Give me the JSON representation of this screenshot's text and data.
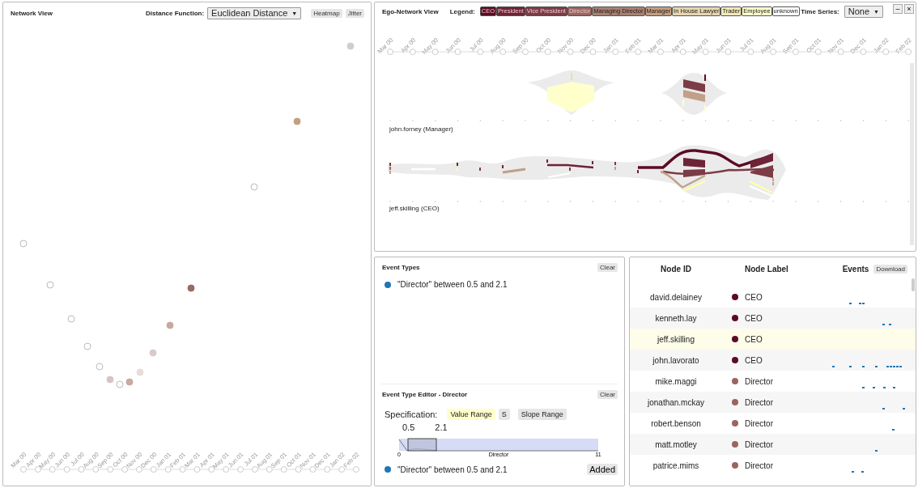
{
  "network_view": {
    "title": "Network View",
    "distance_label": "Distance Function:",
    "distance_value": "Euclidean Distance",
    "dropdown_arrow": "▼",
    "buttons": [
      "Heatmap",
      "Jitter"
    ],
    "timeline": [
      "Mar 00",
      "Apr 00",
      "May 00",
      "Jun 00",
      "Jul 00",
      "Aug 00",
      "Sep 00",
      "Oct 00",
      "Nov 00",
      "Dec 00",
      "Jan 01",
      "Feb 01",
      "Mar 01",
      "Apr 01",
      "May 01",
      "Jun 01",
      "Jul 01",
      "Aug 01",
      "Sep 01",
      "Oct 01",
      "Nov 01",
      "Dec 01",
      "Jan 02",
      "Feb 02"
    ]
  },
  "ego_view": {
    "title": "Ego-Network View",
    "legend_label": "Legend:",
    "legend": [
      {
        "label": "CEO",
        "color": "#5c0b24"
      },
      {
        "label": "President",
        "color": "#6e2336"
      },
      {
        "label": "Vice President",
        "color": "#7c3c45"
      },
      {
        "label": "Director",
        "color": "#9a6560"
      },
      {
        "label": "Managing Director",
        "color": "#a88070"
      },
      {
        "label": "Manager",
        "color": "#c49c80"
      },
      {
        "label": "In House Lawyer",
        "color": "#e6d6b0"
      },
      {
        "label": "Trader",
        "color": "#f2e8b8"
      },
      {
        "label": "Employee",
        "color": "#ffffcc"
      },
      {
        "label": "unknown",
        "color": "#ffffff"
      }
    ],
    "time_series_label": "Time Series:",
    "time_series_value": "None",
    "dropdown_arrow": "▼",
    "window_controls": [
      "–",
      "×"
    ],
    "timeline": [
      "Mar 00",
      "Apr 00",
      "May 00",
      "Jun 00",
      "Jul 00",
      "Aug 00",
      "Sep 00",
      "Oct 00",
      "Nov 00",
      "Dec 00",
      "Jan 01",
      "Feb 01",
      "Mar 01",
      "Apr 01",
      "May 01",
      "Jun 01",
      "Jul 01",
      "Aug 01",
      "Sep 01",
      "Oct 01",
      "Nov 01",
      "Dec 01",
      "Jan 02",
      "Feb 02"
    ],
    "egos": [
      {
        "label": "john.forney (Manager)"
      },
      {
        "label": "jeff.skilling (CEO)"
      }
    ]
  },
  "event_types": {
    "title": "Event Types",
    "clear": "Clear",
    "items": [
      {
        "text": "\"Director\" between 0.5 and 2.1",
        "color": "#1f77b4"
      }
    ]
  },
  "editor": {
    "title": "Event Type Editor - Director",
    "clear": "Clear",
    "spec_label": "Specification:",
    "tabs": [
      {
        "label": "Value Range",
        "selected": true
      },
      {
        "label": "S",
        "selected": false
      },
      {
        "label": "Slope Range",
        "selected": false
      }
    ],
    "range_low": "0.5",
    "range_high": "2.1",
    "axis_min": "0",
    "axis_label": "Director",
    "axis_max": "11",
    "result": {
      "text": "\"Director\" between 0.5 and 2.1",
      "color": "#1f77b4"
    },
    "add_button": "Added"
  },
  "node_table": {
    "columns": [
      "Node ID",
      "Node Label",
      "Events"
    ],
    "download": "Download",
    "rows": [
      {
        "id": "david.delainey",
        "label": "CEO",
        "color": "#5c0b24",
        "selected": false
      },
      {
        "id": "kenneth.lay",
        "label": "CEO",
        "color": "#5c0b24",
        "selected": false
      },
      {
        "id": "jeff.skilling",
        "label": "CEO",
        "color": "#5c0b24",
        "selected": true
      },
      {
        "id": "john.lavorato",
        "label": "CEO",
        "color": "#5c0b24",
        "selected": false
      },
      {
        "id": "mike.maggi",
        "label": "Director",
        "color": "#9a6560",
        "selected": false
      },
      {
        "id": "jonathan.mckay",
        "label": "Director",
        "color": "#9a6560",
        "selected": false
      },
      {
        "id": "robert.benson",
        "label": "Director",
        "color": "#9a6560",
        "selected": false
      },
      {
        "id": "matt.motley",
        "label": "Director",
        "color": "#9a6560",
        "selected": false
      },
      {
        "id": "patrice.mims",
        "label": "Director",
        "color": "#9a6560",
        "selected": false
      }
    ]
  }
}
